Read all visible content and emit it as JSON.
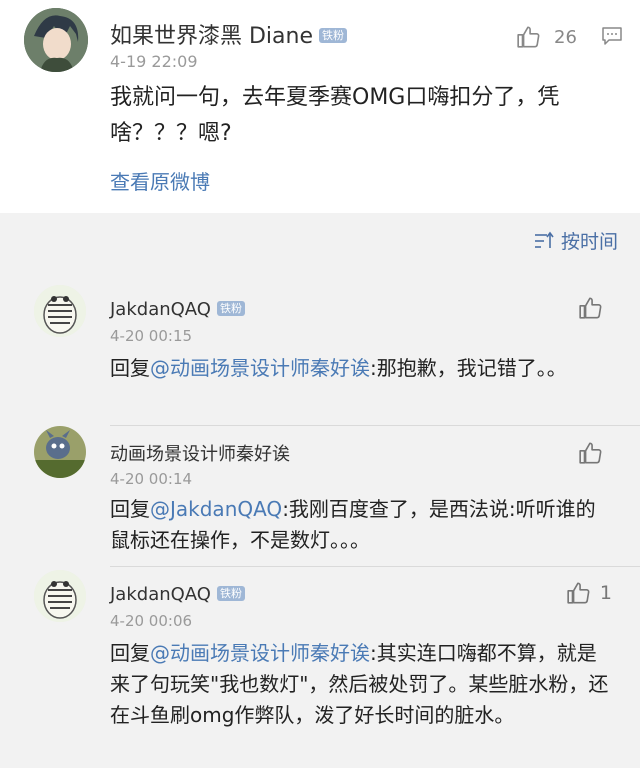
{
  "post": {
    "author_name": "如果世界漆黑 Diane",
    "badge": "铁粉",
    "time": "4-19 22:09",
    "like_count": "26",
    "body": "我就问一句，去年夏季赛OMG口嗨扣分了，凭啥？？？嗯?",
    "view_original": "查看原微博"
  },
  "sort": {
    "label": "按时间"
  },
  "replies": [
    {
      "name": "JakdanQAQ",
      "badge": "铁粉",
      "time": "4-20 00:15",
      "prefix": "回复",
      "mention": "@动画场景设计师秦好诶",
      "text": ":那抱歉，我记错了。。",
      "like_count": ""
    },
    {
      "name": "动画场景设计师秦好诶",
      "badge": "",
      "time": "4-20 00:14",
      "prefix": "回复",
      "mention": "@JakdanQAQ",
      "text": ":我刚百度查了，是西法说:听听谁的鼠标还在操作，不是数灯。。。",
      "like_count": ""
    },
    {
      "name": "JakdanQAQ",
      "badge": "铁粉",
      "time": "4-20 00:06",
      "prefix": "回复",
      "mention": "@动画场景设计师秦好诶",
      "text": ":其实连口嗨都不算，就是来了句玩笑\"我也数灯\"，然后被处罚了。某些脏水粉，还在斗鱼刷omg作弊队，泼了好长时间的脏水。",
      "like_count": "1"
    }
  ],
  "colors": {
    "link": "#4a7ab5",
    "badge": "#9fb7d6",
    "meta": "#9a9a9a",
    "background_replies": "#f2f2f2"
  },
  "icons": {
    "like": "thumbs-up-icon",
    "comment": "comment-bubble-icon",
    "sort": "sort-lines-icon"
  }
}
